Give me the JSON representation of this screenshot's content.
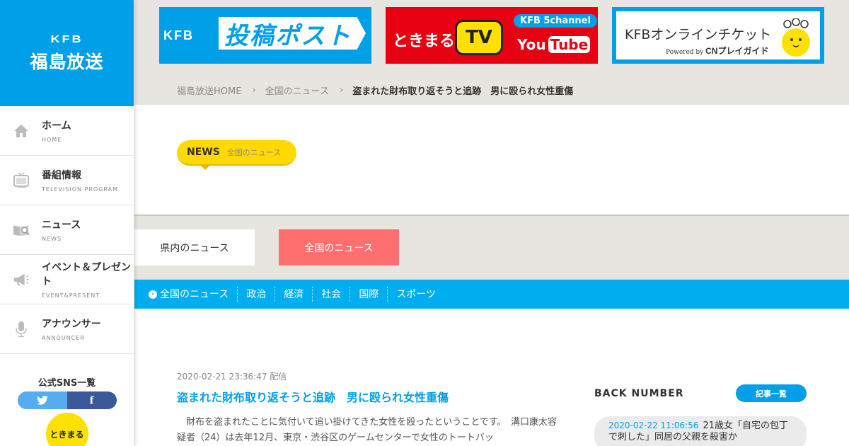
{
  "sidebar": {
    "logo_top": "KFB",
    "logo_main": "福島放送",
    "items": [
      {
        "label": "ホーム",
        "sub": "HOME",
        "icon": "home-icon"
      },
      {
        "label": "番組情報",
        "sub": "TELEVISION PROGRAM",
        "icon": "tv-icon"
      },
      {
        "label": "ニュース",
        "sub": "NEWS",
        "icon": "news-icon"
      },
      {
        "label": "イベント＆プレゼント",
        "sub": "EVENT&PRESENT",
        "icon": "megaphone-icon"
      },
      {
        "label": "アナウンサー",
        "sub": "ANNOUNCER",
        "icon": "microphone-icon"
      }
    ],
    "sns_title": "公式SNS一覧",
    "sns_twitter": "twitter-icon",
    "sns_facebook": "f",
    "tokimaru": "ときまる"
  },
  "banners": {
    "post": {
      "kfb": "KFB",
      "text": "投稿ポスト"
    },
    "tokimaru": {
      "text": "ときまる",
      "tv": "TV",
      "channel": "KFB 5channel",
      "you": "You",
      "tube": "Tube"
    },
    "ticket": {
      "title": "KFBオンラインチケット",
      "powered": "Powered by",
      "brand": "CNプレイガイド"
    }
  },
  "breadcrumb": {
    "home": "福島放送HOME",
    "section": "全国のニュース",
    "current": "盗まれた財布取り返そうと追跡　男に殴られ女性重傷",
    "sep": "›"
  },
  "badge": {
    "label": "NEWS",
    "sub": "全国のニュース"
  },
  "tabs": {
    "pref": "県内のニュース",
    "national": "全国のニュース"
  },
  "categories": [
    "全国のニュース",
    "政治",
    "経済",
    "社会",
    "国際",
    "スポーツ"
  ],
  "article": {
    "date": "2020-02-21 23:36:47 配信",
    "title": "盗まれた財布取り返そうと追跡　男に殴られ女性重傷",
    "body": "財布を盗まれたことに気付いて追い掛けてきた女性を殴ったということです。　溝口康太容疑者（24）は去年12月、東京・渋谷区のゲームセンターで女性のトートバッ"
  },
  "back_number": {
    "title": "BACK NUMBER",
    "button": "記事一覧",
    "items": [
      {
        "date": "2020-02-22 11:06:56",
        "text": "21歳女「自宅の包丁で刺した」同居の父親を殺害か"
      }
    ]
  },
  "colors": {
    "brand": "#00a0e9",
    "badge": "#ffd900",
    "tab_active": "#ff6f6f",
    "category_bar": "#00aeef"
  }
}
